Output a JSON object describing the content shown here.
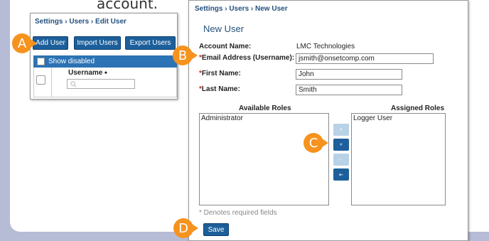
{
  "caption": "account.",
  "panel1": {
    "breadcrumb": "Settings › Users › Edit User",
    "buttons": {
      "add_user": "Add User",
      "import_users": "Import Users",
      "export_users": "Export Users"
    },
    "show_disabled": "Show disabled",
    "username_header": "Username ⬩"
  },
  "panel2": {
    "breadcrumb": "Settings › Users › New User",
    "title": "New User",
    "account_name_label": "Account Name:",
    "account_name_value": "LMC Technologies",
    "email_label": "Email Address (Username):",
    "email_value": "jsmith@onsetcomp.com",
    "first_name_label": "First Name:",
    "first_name_value": "John",
    "last_name_label": "Last Name:",
    "last_name_value": "Smith",
    "required_mark": "*",
    "available_roles_header": "Available Roles",
    "assigned_roles_header": "Assigned Roles",
    "available_roles": [
      "Administrator"
    ],
    "assigned_roles": [
      "Logger User"
    ],
    "move_buttons": [
      "»",
      "«",
      "←",
      "⇤"
    ],
    "required_note": "* Denotes required fields",
    "save_label": "Save"
  },
  "markers": {
    "a": "A",
    "b": "B",
    "c": "C",
    "d": "D"
  },
  "colors": {
    "marker": "#f6921e",
    "button": "#1c5f9b",
    "header_bar": "#2c73b5",
    "breadcrumb": "#24507d",
    "frame": "#b6bcd5"
  }
}
